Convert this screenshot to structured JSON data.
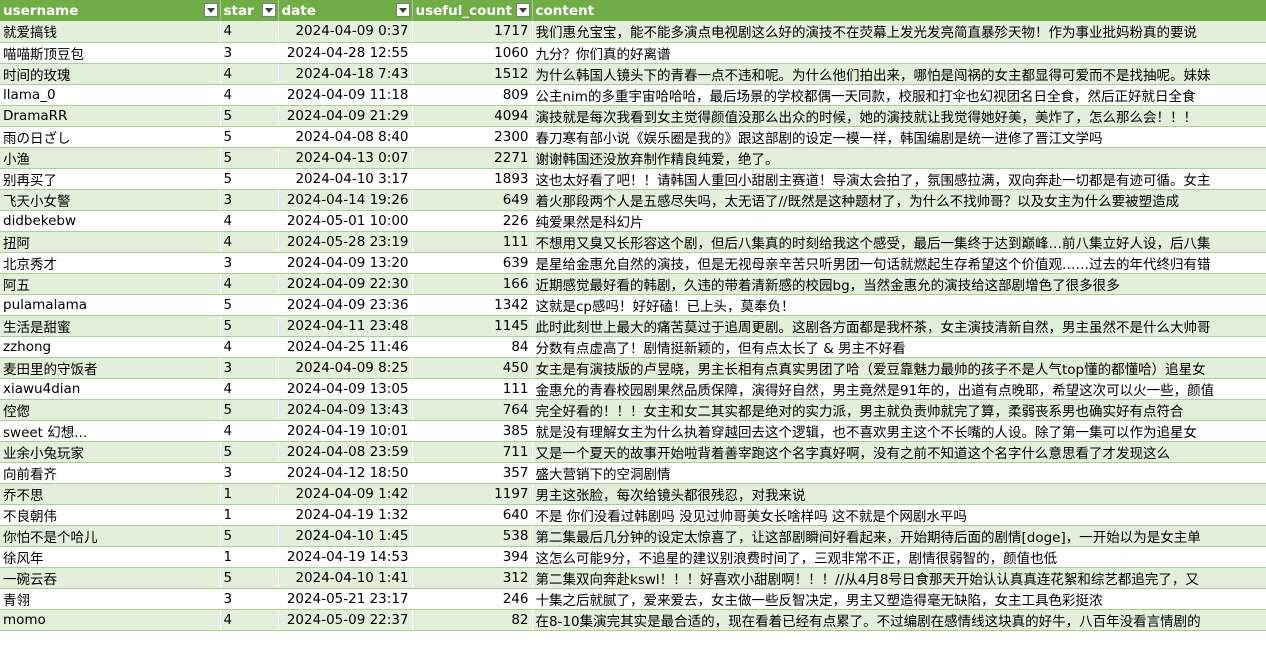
{
  "headers": {
    "username": "username",
    "star": "star",
    "date": "date",
    "useful_count": "useful_count",
    "content": "content"
  },
  "rows": [
    {
      "username": "就爱搞钱",
      "star": "4",
      "date": "2024-04-09 0:37",
      "useful": "1717",
      "content": "我们惠允宝宝，能不能多演点电视剧这么好的演技不在荧幕上发光发亮简直暴殄天物！作为事业批妈粉真的要说"
    },
    {
      "username": "喵喵斯顶豆包",
      "star": "3",
      "date": "2024-04-28 12:55",
      "useful": "1060",
      "content": "九分？你们真的好离谱"
    },
    {
      "username": "时间的玫瑰",
      "star": "4",
      "date": "2024-04-18 7:43",
      "useful": "1512",
      "content": "为什么韩国人镜头下的青春一点不违和呢。为什么他们拍出来，哪怕是闯祸的女主都显得可爱而不是找抽呢。妹妹"
    },
    {
      "username": "llama_0",
      "star": "4",
      "date": "2024-04-09 11:18",
      "useful": "809",
      "content": "公主nim的多重宇宙哈哈哈，最后场景的学校都偶一天同款，校服和打伞也幻视团名日全食，然后正好就日全食"
    },
    {
      "username": "DramaRR",
      "star": "5",
      "date": "2024-04-09 21:29",
      "useful": "4094",
      "content": "演技就是每次我看到女主觉得颜值没那么出众的时候，她的演技就让我觉得她好美，美炸了，怎么那么会！！！"
    },
    {
      "username": "雨の日ざし",
      "star": "5",
      "date": "2024-04-08 8:40",
      "useful": "2300",
      "content": "春刀寒有部小说《娱乐圈是我的》跟这部剧的设定一模一样，韩国编剧是统一进修了晋江文学吗"
    },
    {
      "username": "小渔",
      "star": "5",
      "date": "2024-04-13 0:07",
      "useful": "2271",
      "content": "谢谢韩国还没放弃制作精良纯爱，绝了。"
    },
    {
      "username": "别再买了",
      "star": "5",
      "date": "2024-04-10 3:17",
      "useful": "1893",
      "content": "这也太好看了吧！！请韩国人重回小甜剧主赛道！导演太会拍了，氛围感拉满，双向奔赴一切都是有迹可循。女主"
    },
    {
      "username": "飞天小女警",
      "star": "3",
      "date": "2024-04-14 19:26",
      "useful": "649",
      "content": "着火那段两个人是五感尽失吗，太无语了//既然是这种题材了，为什么不找帅哥？以及女主为什么要被塑造成"
    },
    {
      "username": "didbekebw",
      "star": "4",
      "date": "2024-05-01 10:00",
      "useful": "226",
      "content": "纯爱果然是科幻片"
    },
    {
      "username": "扭阿",
      "star": "4",
      "date": "2024-05-28 23:19",
      "useful": "111",
      "content": "不想用又臭又长形容这个剧，但后八集真的时刻给我这个感受，最后一集终于达到巅峰…前八集立好人设，后八集"
    },
    {
      "username": "北京秀才",
      "star": "3",
      "date": "2024-04-09 13:20",
      "useful": "639",
      "content": "是星给金惠允自然的演技，但是无视母亲辛苦只听男团一句话就燃起生存希望这个价值观……过去的年代终归有错"
    },
    {
      "username": "阿五",
      "star": "4",
      "date": "2024-04-09 22:30",
      "useful": "166",
      "content": "近期感觉最好看的韩剧，久违的带着清新感的校园bg，当然金惠允的演技给这部剧增色了很多很多"
    },
    {
      "username": "pulamalama",
      "star": "5",
      "date": "2024-04-09 23:36",
      "useful": "1342",
      "content": "这就是cp感吗！好好磕！已上头，莫奉负！"
    },
    {
      "username": "生活是甜蜜",
      "star": "5",
      "date": "2024-04-11 23:48",
      "useful": "1145",
      "content": "此时此刻世上最大的痛苦莫过于追周更剧。这剧各方面都是我杯茶，女主演技清新自然，男主虽然不是什么大帅哥"
    },
    {
      "username": "zzhong",
      "star": "4",
      "date": "2024-04-25 11:46",
      "useful": "84",
      "content": "分数有点虚高了！剧情挺新颖的，但有点太长了 & 男主不好看"
    },
    {
      "username": "麦田里的守饭者",
      "star": "3",
      "date": "2024-04-09 8:25",
      "useful": "450",
      "content": "女主是有演技版的卢昱晓，男主长相有点真实男团了哈（爱豆靠魅力最帅的孩子不是人气top懂的都懂哈）追星女"
    },
    {
      "username": "xiawu4dian",
      "star": "4",
      "date": "2024-04-09 13:05",
      "useful": "111",
      "content": "金惠允的青春校园剧果然品质保障，演得好自然，男主竟然是91年的，出道有点晚耶，希望这次可以火一些，颜值"
    },
    {
      "username": "倥偬",
      "star": "5",
      "date": "2024-04-09 13:43",
      "useful": "764",
      "content": "完全好看的！！！女主和女二其实都是绝对的实力派，男主就负责帅就完了算，柔弱丧系男也确实好有点符合"
    },
    {
      "username": "sweet 幻想...",
      "star": "4",
      "date": "2024-04-19 10:01",
      "useful": "385",
      "content": "就是没有理解女主为什么执着穿越回去这个逻辑，也不喜欢男主这个不长嘴的人设。除了第一集可以作为追星女"
    },
    {
      "username": "业余小兔玩家",
      "star": "5",
      "date": "2024-04-08 23:59",
      "useful": "711",
      "content": "又是一个夏天的故事开始啦背着善宰跑这个名字真好啊，没有之前不知道这个名字什么意思看了才发现这么"
    },
    {
      "username": "向前看齐",
      "star": "3",
      "date": "2024-04-12 18:50",
      "useful": "357",
      "content": "盛大营销下的空洞剧情"
    },
    {
      "username": "乔不思",
      "star": "1",
      "date": "2024-04-09 1:42",
      "useful": "1197",
      "content": "男主这张脸，每次给镜头都很残忍，对我来说"
    },
    {
      "username": "不良朝伟",
      "star": "1",
      "date": "2024-04-19 1:32",
      "useful": "640",
      "content": "不是 你们没看过韩剧吗 没见过帅哥美女长啥样吗 这不就是个网剧水平吗"
    },
    {
      "username": "你怕不是个哈儿",
      "star": "5",
      "date": "2024-04-10 1:45",
      "useful": "538",
      "content": "第二集最后几分钟的设定太惊喜了，让这部剧瞬间好看起来，开始期待后面的剧情[doge]，一开始以为是女主单"
    },
    {
      "username": "徐风年",
      "star": "1",
      "date": "2024-04-19 14:53",
      "useful": "394",
      "content": "这怎么可能9分，不追星的建议别浪费时间了，三观非常不正，剧情很弱智的，颜值也低"
    },
    {
      "username": "一碗云吞",
      "star": "5",
      "date": "2024-04-10 1:41",
      "useful": "312",
      "content": "第二集双向奔赴kswl！！！好喜欢小甜剧啊！！！//从4月8号日食那天开始认认真真连花絮和综艺都追完了，又"
    },
    {
      "username": "青翎",
      "star": "3",
      "date": "2024-05-21 23:17",
      "useful": "246",
      "content": "十集之后就腻了，爱来爱去，女主做一些反智决定，男主又塑造得毫无缺陷，女主工具色彩挺浓"
    },
    {
      "username": "momo",
      "star": "4",
      "date": "2024-05-09 22:37",
      "useful": "82",
      "content": "在8-10集演完其实是最合适的，现在看着已经有点累了。不过编剧在感情线这块真的好牛，八百年没看言情剧的"
    }
  ]
}
